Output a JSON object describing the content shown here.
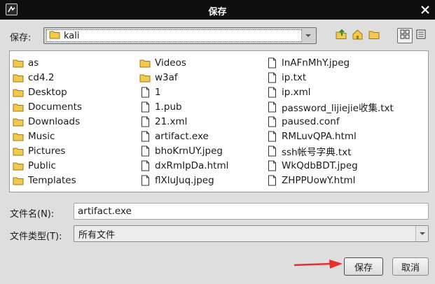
{
  "window": {
    "title": "保存"
  },
  "lookin": {
    "label": "保存:",
    "value": "kali"
  },
  "files": {
    "col1": [
      {
        "name": "as",
        "icon": "folder-icon"
      },
      {
        "name": "cd4.2",
        "icon": "folder-icon"
      },
      {
        "name": "Desktop",
        "icon": "folder-icon"
      },
      {
        "name": "Documents",
        "icon": "folder-icon"
      },
      {
        "name": "Downloads",
        "icon": "folder-icon"
      },
      {
        "name": "Music",
        "icon": "folder-icon"
      },
      {
        "name": "Pictures",
        "icon": "folder-icon"
      },
      {
        "name": "Public",
        "icon": "folder-icon"
      },
      {
        "name": "Templates",
        "icon": "folder-icon"
      }
    ],
    "col2": [
      {
        "name": "Videos",
        "icon": "folder-icon"
      },
      {
        "name": "w3af",
        "icon": "folder-icon"
      },
      {
        "name": "1",
        "icon": "file-icon"
      },
      {
        "name": "1.pub",
        "icon": "file-icon"
      },
      {
        "name": "21.xml",
        "icon": "file-icon"
      },
      {
        "name": "artifact.exe",
        "icon": "file-icon"
      },
      {
        "name": "bhoKrnUY.jpeg",
        "icon": "file-icon"
      },
      {
        "name": "dxRmIpDa.html",
        "icon": "file-icon"
      },
      {
        "name": "flXluJuq.jpeg",
        "icon": "file-icon"
      }
    ],
    "col3": [
      {
        "name": "lnAFnMhY.jpeg",
        "icon": "file-icon"
      },
      {
        "name": "ip.txt",
        "icon": "file-icon"
      },
      {
        "name": "ip.xml",
        "icon": "file-icon"
      },
      {
        "name": "password_lijiejie收集.txt",
        "icon": "file-icon"
      },
      {
        "name": "paused.conf",
        "icon": "file-icon"
      },
      {
        "name": "RMLuvQPA.html",
        "icon": "file-icon"
      },
      {
        "name": "ssh帐号字典.txt",
        "icon": "file-icon"
      },
      {
        "name": "WkQdbBDT.jpeg",
        "icon": "file-icon"
      },
      {
        "name": "ZHPPUowY.html",
        "icon": "file-icon"
      }
    ]
  },
  "filename": {
    "label": "文件名(N):",
    "value": "artifact.exe"
  },
  "filetype": {
    "label": "文件类型(T):",
    "value": "所有文件"
  },
  "buttons": {
    "save": "保存",
    "cancel": "取消"
  },
  "colors": {
    "titlebar": "#0f0f0f",
    "annotation_arrow": "#e8302a",
    "folder": "#f2c94c"
  }
}
